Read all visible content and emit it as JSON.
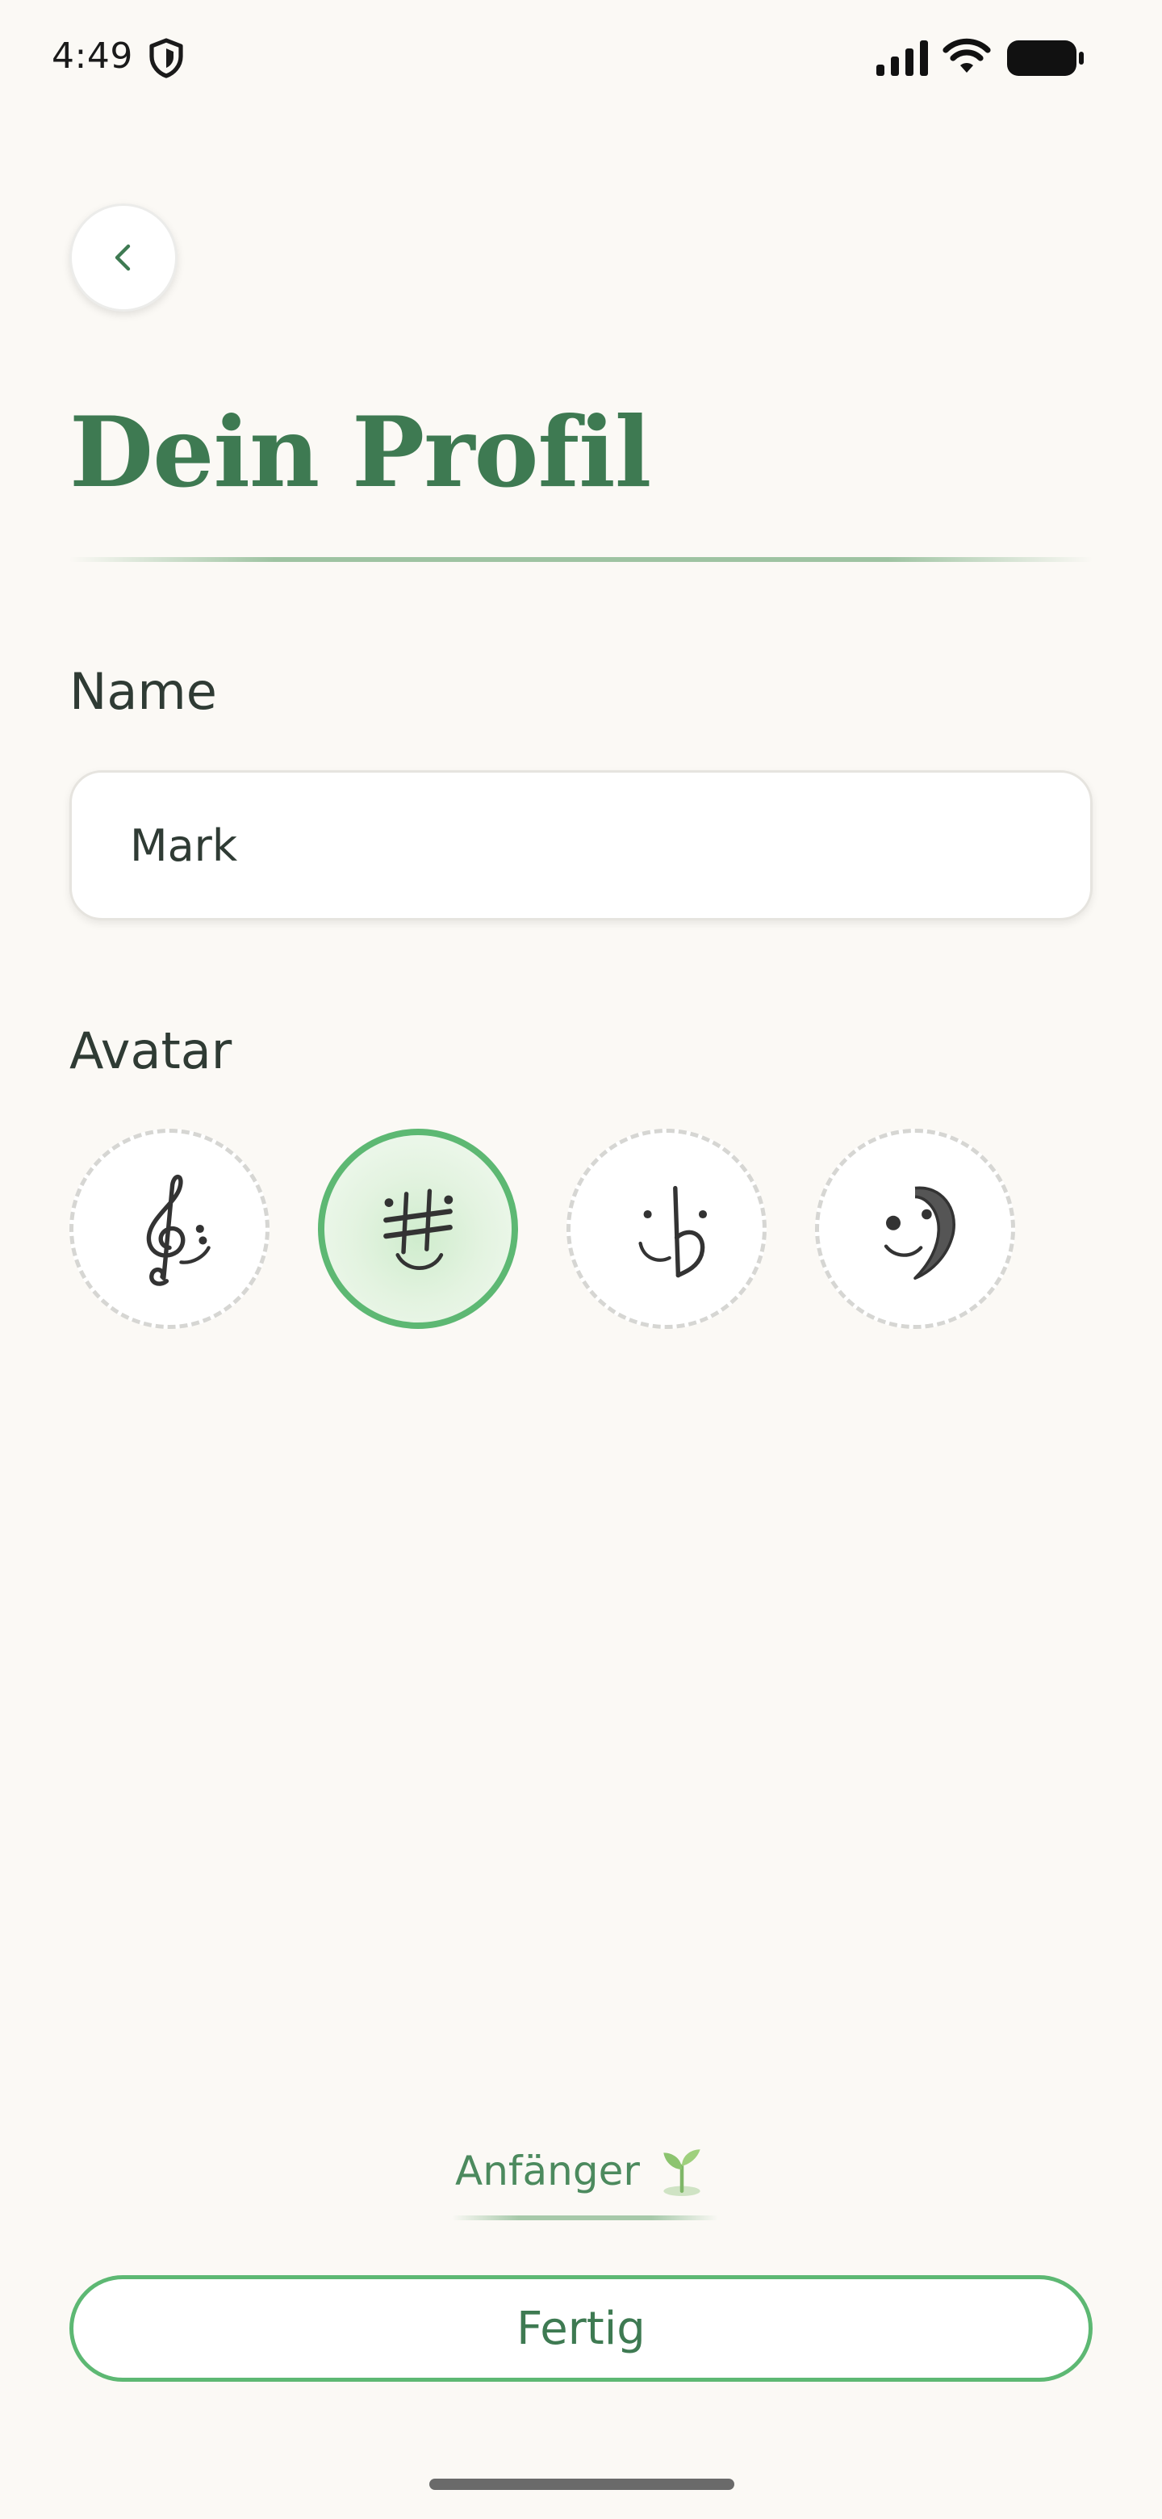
{
  "status_bar": {
    "time": "4:49",
    "icons": [
      "shield-icon",
      "signal-icon",
      "wifi-icon",
      "battery-icon"
    ]
  },
  "header": {
    "back_icon": "chevron-left-icon",
    "title": "Dein Profil"
  },
  "form": {
    "name_label": "Name",
    "name_value": "Mark",
    "avatar_label": "Avatar",
    "avatars": [
      {
        "icon": "treble-clef-face-icon",
        "selected": false
      },
      {
        "icon": "sharp-face-icon",
        "selected": true
      },
      {
        "icon": "flat-face-icon",
        "selected": false
      },
      {
        "icon": "bass-clef-face-icon",
        "selected": false
      }
    ]
  },
  "footer": {
    "level_text": "Anfänger",
    "level_icon": "sprout-icon",
    "done_label": "Fertig"
  },
  "colors": {
    "accent": "#3e7a52",
    "selected_border": "#5db873",
    "background": "#fbf9f5"
  }
}
